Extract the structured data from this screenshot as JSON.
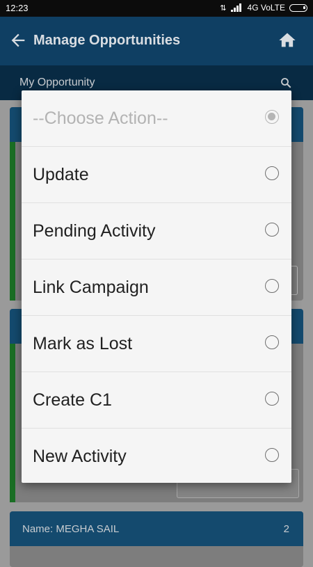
{
  "status_bar": {
    "time": "12:23",
    "network": "4G VoLTE"
  },
  "app_bar": {
    "title": "Manage Opportunities",
    "back_icon": "arrow-back-icon",
    "home_icon": "home-icon"
  },
  "sub_bar": {
    "label": "My Opportunity",
    "search_icon": "search-icon"
  },
  "background": {
    "cards": [
      {
        "name_label": "",
        "count": ""
      },
      {
        "name_label": "",
        "count": ""
      },
      {
        "name_label": "Name: MEGHA SAIL",
        "count": "2"
      }
    ]
  },
  "dialog": {
    "options": [
      {
        "label": "--Choose Action--",
        "selected": true,
        "placeholder": true
      },
      {
        "label": "Update",
        "selected": false
      },
      {
        "label": "Pending Activity",
        "selected": false
      },
      {
        "label": "Link Campaign",
        "selected": false
      },
      {
        "label": "Mark as Lost",
        "selected": false
      },
      {
        "label": "Create C1",
        "selected": false
      },
      {
        "label": "New Activity",
        "selected": false
      }
    ]
  },
  "colors": {
    "app_bar": "#0f3f63",
    "sub_bar": "#082a43",
    "stripe": "#1a6e24",
    "dialog_bg": "#f5f5f5"
  }
}
